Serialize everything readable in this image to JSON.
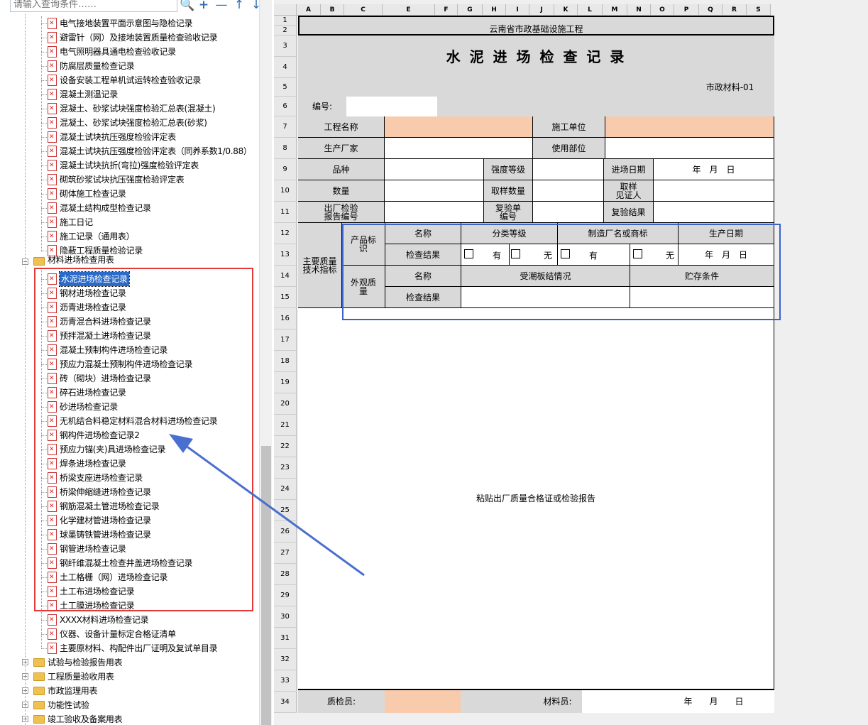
{
  "search": {
    "placeholder": "请输入查询条件……"
  },
  "toolbar": {
    "search": "🔍",
    "add": "+",
    "remove": "—",
    "up": "↑",
    "down": "↓"
  },
  "tree": {
    "items_top": [
      "电气接地装置平面示意图与隐检记录",
      "避雷针（网）及接地装置质量检查验收记录",
      "电气照明器具通电检查验收记录",
      "防腐层质量检查记录",
      "设备安装工程单机试运转检查验收记录",
      "混凝土测温记录",
      "混凝土、砂浆试块强度检验汇总表(混凝土)",
      "混凝土、砂浆试块强度检验汇总表(砂浆)",
      "混凝土试块抗压强度检验评定表",
      "混凝土试块抗压强度检验评定表（同养系数1/0.88）",
      "混凝土试块抗折(弯拉)强度检验评定表",
      "砌筑砂浆试块抗压强度检验评定表",
      "砌体施工检查记录",
      "混凝土结构成型检查记录",
      "施工日记",
      "施工记录（通用表）",
      "隐蔽工程质量检验记录"
    ],
    "folder_materials": "材料进场检查用表",
    "items_materials": [
      "水泥进场检查记录",
      "钢材进场检查记录",
      "沥青进场检查记录",
      "沥青混合料进场检查记录",
      "预拌混凝土进场检查记录",
      "混凝土预制构件进场检查记录",
      "预应力混凝土预制构件进场检查记录",
      "砖（砌块）进场检查记录",
      "碎石进场检查记录",
      "砂进场检查记录",
      "无机结合料稳定材料混合材料进场检查记录",
      "钢构件进场检查记录2",
      "预应力锚(夹)具进场检查记录",
      "焊条进场检查记录",
      "桥梁支座进场检查记录",
      "桥梁伸缩缝进场检查记录",
      "钢筋混凝土管进场检查记录",
      "化学建材管进场检查记录",
      "球墨铸铁管进场检查记录",
      "钢管进场检查记录",
      "钢纤维混凝土检查井盖进场检查记录",
      "土工格栅（网）进场检查记录",
      "土工布进场检查记录",
      "土工膜进场检查记录",
      "XXXX材料进场检查记录",
      "仪器、设备计量标定合格证清单",
      "主要原材料、构配件出厂证明及复试单目录"
    ],
    "folders_bottom": [
      "试验与检验报告用表",
      "工程质量验收用表",
      "市政监理用表",
      "功能性试验",
      "竣工验收及备案用表"
    ]
  },
  "sheet": {
    "columns": [
      "A",
      "B",
      "C",
      "E",
      "F",
      "G",
      "H",
      "I",
      "J",
      "K",
      "L",
      "M",
      "N",
      "O",
      "P",
      "Q",
      "R",
      "S"
    ],
    "rows": [
      "1",
      "2",
      "3",
      "4",
      "5",
      "6",
      "7",
      "8",
      "9",
      "10",
      "11",
      "12",
      "13",
      "14",
      "15",
      "16",
      "17",
      "18",
      "19",
      "20",
      "21",
      "22",
      "23",
      "24",
      "25",
      "26",
      "27",
      "28",
      "29",
      "30",
      "31",
      "32",
      "33",
      "34"
    ],
    "org": "云南省市政基础设施工程",
    "title": "水 泥 进 场 检 查 记 录",
    "code": "市政材料-01",
    "bianhao": "编号:",
    "l_gcmc": "工程名称",
    "l_sgdw": "施工单位",
    "l_scjc": "生产厂家",
    "l_sybw": "使用部位",
    "l_pz": "品种",
    "l_qddj": "强度等级",
    "l_jcrq": "进场日期",
    "ymd": "年　月　日",
    "l_sl": "数量",
    "l_qysl": "取样数量",
    "l_qyjzr": "取样\n见证人",
    "l_ccjy": "出厂检验\n报告编号",
    "l_fyd": "复验单\n编号",
    "l_fyjg": "复验结果",
    "l_zyzl": "主要质量\n技术指标",
    "l_cpbs": "产品标\n识",
    "l_mc": "名称",
    "l_fldj": "分类等级",
    "l_zzcm": "制造厂名或商标",
    "l_scrq": "生产日期",
    "l_jcjg": "检查结果",
    "you": "有",
    "wu": "无",
    "l_wgzl": "外观质\n量",
    "l_scbj": "受潮板结情况",
    "l_zctj": "贮存条件",
    "paste": "粘贴出厂质量合格证或检验报告",
    "l_zjy": "质检员:",
    "l_cly": "材料员:",
    "date_bottom": "年　　月　　日"
  },
  "annotation_colors": {
    "red_box": "#e53935",
    "blue_box": "#3a63c9"
  }
}
